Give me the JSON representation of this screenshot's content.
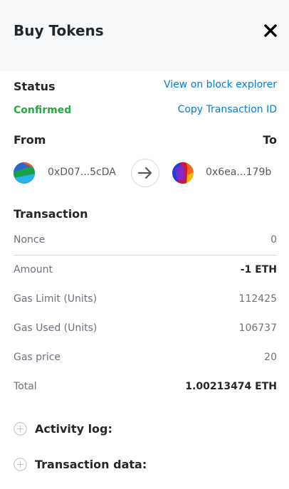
{
  "header": {
    "title": "Buy Tokens",
    "close_icon": "close-icon"
  },
  "status": {
    "heading": "Status",
    "value": "Confirmed",
    "value_color": "#28a745",
    "view_explorer_link": "View on block explorer",
    "copy_tx_link": "Copy Transaction ID"
  },
  "from_to": {
    "from_label": "From",
    "to_label": "To",
    "from_address": "0xD07...5cDA",
    "to_address": "0x6ea...179b",
    "arrow_icon": "arrow-right-icon"
  },
  "transaction": {
    "heading": "Transaction",
    "rows": [
      {
        "label": "Nonce",
        "value": "0"
      },
      {
        "label": "Amount",
        "value": "-1 ETH"
      },
      {
        "label": "Gas Limit (Units)",
        "value": "112425"
      },
      {
        "label": "Gas Used (Units)",
        "value": "106737"
      },
      {
        "label": "Gas price",
        "value": "20"
      },
      {
        "label": "Total",
        "value": "1.00213474 ETH"
      }
    ]
  },
  "sections": {
    "activity_log": "Activity log:",
    "transaction_data": "Transaction data:"
  },
  "colors": {
    "link": "#037dd6",
    "header_bg": "#f8f9fa",
    "text": "#24272a"
  }
}
